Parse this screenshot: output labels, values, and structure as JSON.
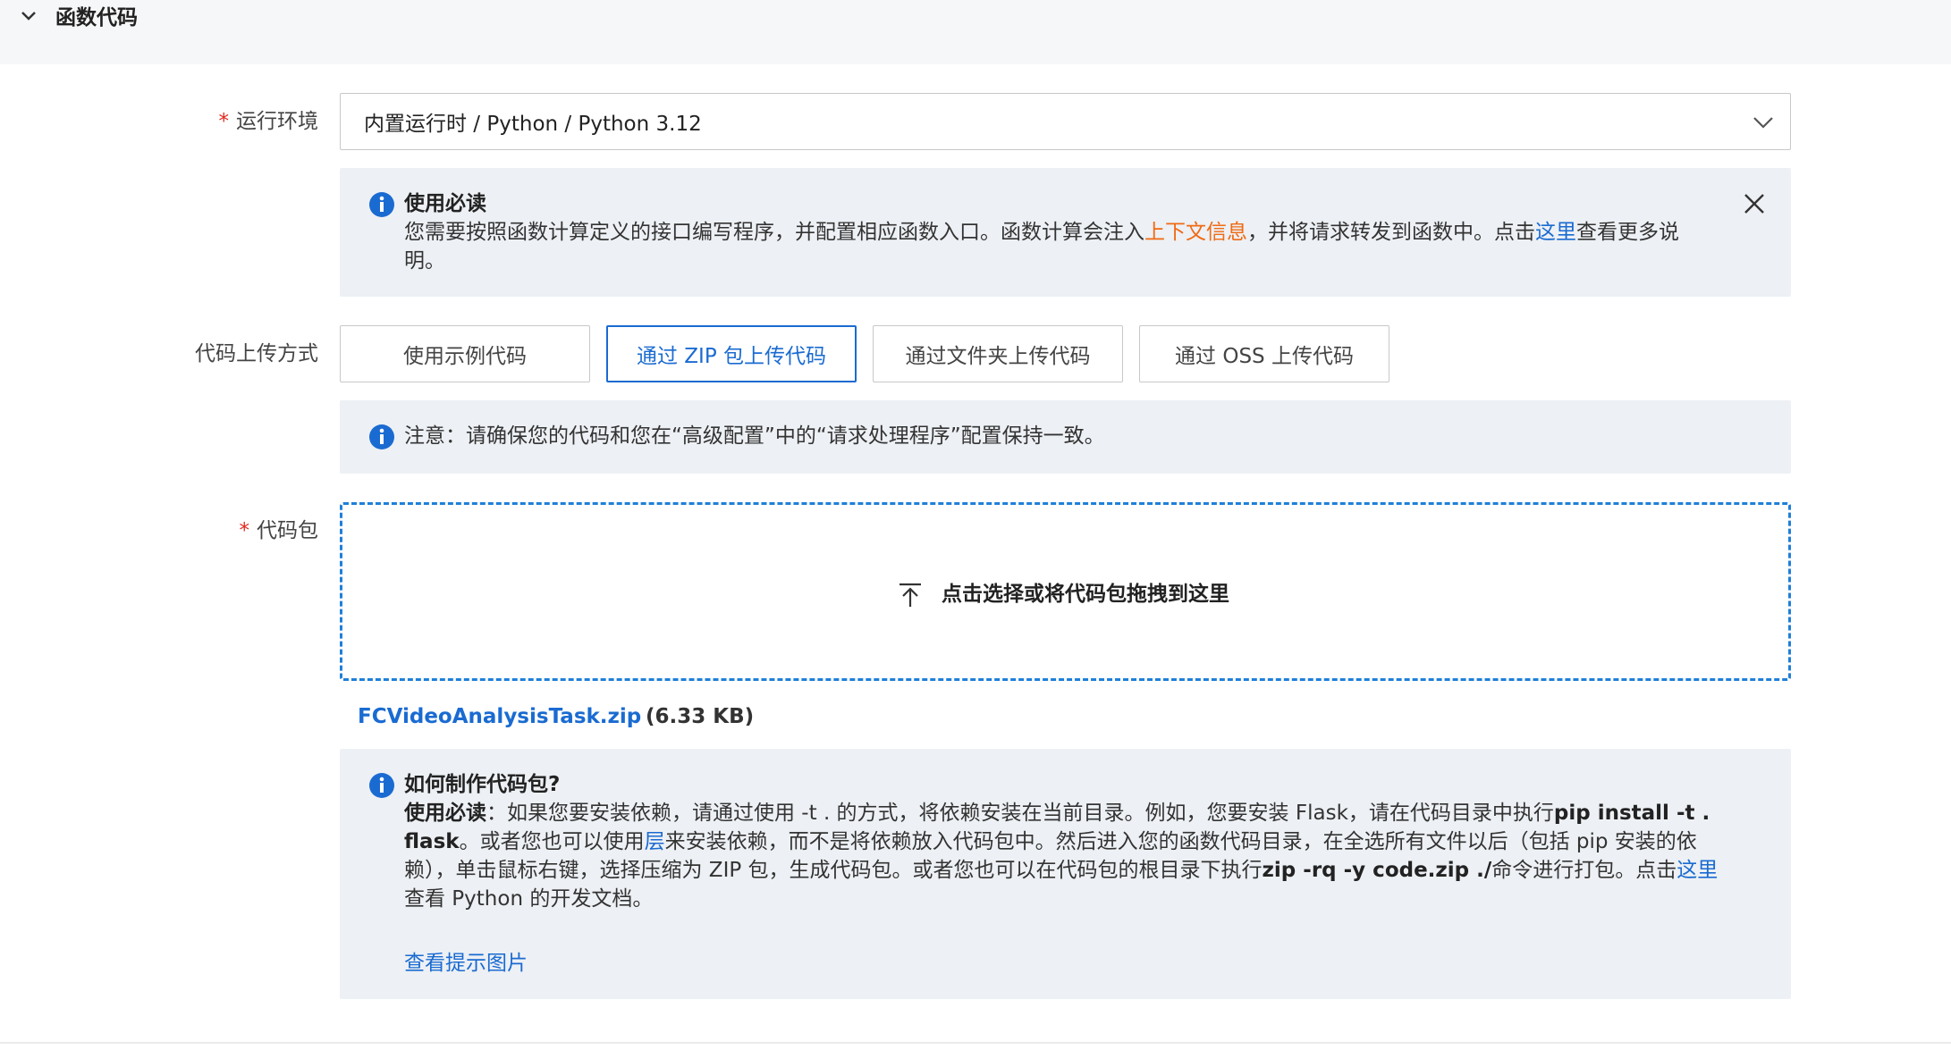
{
  "section": {
    "title": "函数代码"
  },
  "runtime": {
    "label": "运行环境",
    "required_mark": "*",
    "value": "内置运行时 / Python /  Python 3.12"
  },
  "notice1": {
    "title": "使用必读",
    "text_before": "您需要按照函数计算定义的接口编写程序，并配置相应函数入口。函数计算会注入",
    "link_context": "上下文信息",
    "text_middle": "，并将请求转发到函数中。点击",
    "link_here": "这里",
    "text_after": "查看更多说",
    "text_line2": "明。"
  },
  "upload_method": {
    "label": "代码上传方式",
    "options": [
      "使用示例代码",
      "通过 ZIP 包上传代码",
      "通过文件夹上传代码",
      "通过 OSS 上传代码"
    ],
    "selected": "通过 ZIP 包上传代码"
  },
  "notice2": {
    "text": "注意：请确保您的代码和您在“高级配置”中的“请求处理程序”配置保持一致。"
  },
  "code_package": {
    "label": "代码包",
    "required_mark": "*",
    "drop_text": "点击选择或将代码包拖拽到这里",
    "file_name": "FCVideoAnalysisTask.zip",
    "file_size": "(6.33 KB)"
  },
  "notice3": {
    "title": "如何制作代码包?",
    "l1_bold": "使用必读",
    "l1_text": "：如果您要安装依赖，请通过使用 -t . 的方式，将依赖安装在当前目录。例如，您要安装 Flask，请在代码目录中执行",
    "l1_cmd": "pip install -t .",
    "l2_cmd": "flask",
    "l2_text_a": "。或者您也可以使用",
    "l2_link": "层",
    "l2_text_b": "来安装依赖，而不是将依赖放入代码包中。然后进入您的函数代码目录，在全选所有文件以后（包括 pip 安装的依",
    "l3_text_a": "赖），单击鼠标右键，选择压缩为 ZIP 包，生成代码包。或者您也可以在代码包的根目录下执行",
    "l3_cmd": "zip -rq -y code.zip ./",
    "l3_text_b": "命令进行打包。点击",
    "l3_link": "这里",
    "l4_text": "查看 Python 的开发文档。",
    "view_image_link": "查看提示图片"
  },
  "colors": {
    "accent": "#1a6bd1",
    "orange_link": "#f06a13",
    "required": "#e0281e",
    "info_bg": "#edf0f4",
    "dropzone_border": "#1f7fd8"
  }
}
